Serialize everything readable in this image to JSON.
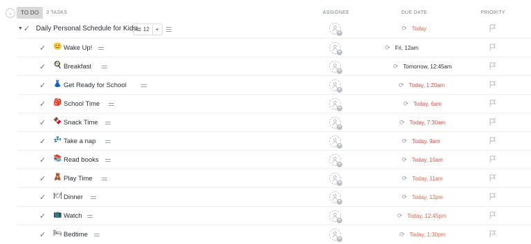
{
  "header": {
    "status_label": "TO DO",
    "task_count": "3 TASKS",
    "col_assignee": "ASSIGNEE",
    "col_due": "DUE DATE",
    "col_priority": "PRIORITY"
  },
  "parent_task": {
    "title": "Daily Personal Schedule for Kids",
    "subtask_count": "12",
    "add_symbol": "+",
    "due": "Today",
    "due_color": "#e8684a",
    "icons": [
      "caret-down-icon",
      "check-icon",
      "subtask-icon",
      "description-icon",
      "assignee-add-icon",
      "repeat-icon",
      "flag-icon"
    ]
  },
  "subtasks": [
    {
      "title": "Wake Up!",
      "emoji": "😊",
      "due": "Fri, 12am",
      "due_color": "#2a2e34"
    },
    {
      "title": "Breakfast",
      "emoji": "🍳",
      "due": "Tomorrow, 12:45am",
      "due_color": "#2a2e34"
    },
    {
      "title": "Get Ready for School",
      "emoji": "👗",
      "due": "Today, 1:20am",
      "due_color": "#e84a4a"
    },
    {
      "title": "School Time",
      "emoji": "🎒",
      "due": "Today, 6am",
      "due_color": "#e84a4a"
    },
    {
      "title": "Snack Time",
      "emoji": "🍫",
      "due": "Today, 7:30am",
      "due_color": "#e84a4a"
    },
    {
      "title": "Take a nap",
      "emoji": "💤",
      "due": "Today, 9am",
      "due_color": "#e84a4a"
    },
    {
      "title": "Read books",
      "emoji": "📚",
      "due": "Today, 10am",
      "due_color": "#e84a4a"
    },
    {
      "title": "Play Time",
      "emoji": "🧸",
      "due": "Today, 11am",
      "due_color": "#e8684a"
    },
    {
      "title": "Dinner",
      "emoji": "🍽",
      "due": "Today, 12pm",
      "due_color": "#e8684a"
    },
    {
      "title": "Watch",
      "emoji": "📺",
      "due": "Today, 12:45pm",
      "due_color": "#e8684a"
    },
    {
      "title": "Bedtime",
      "emoji": "🛏",
      "due": "Today, 1:30pm",
      "due_color": "#e8684a"
    }
  ]
}
